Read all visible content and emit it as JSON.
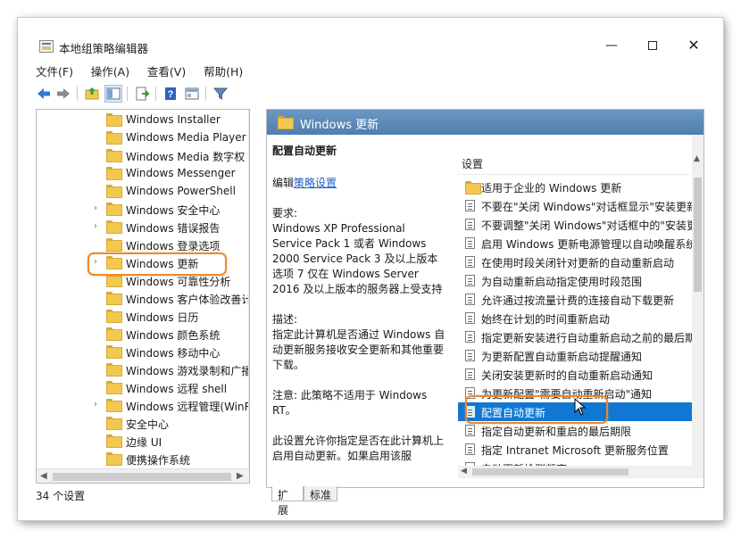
{
  "window": {
    "title": "本地组策略编辑器",
    "minimize": "—",
    "close": "✕"
  },
  "menu": [
    "文件(F)",
    "操作(A)",
    "查看(V)",
    "帮助(H)"
  ],
  "tree": {
    "items": [
      {
        "label": "Windows Installer",
        "expandable": false
      },
      {
        "label": "Windows Media Player",
        "expandable": false
      },
      {
        "label": "Windows Media 数字权",
        "expandable": false
      },
      {
        "label": "Windows Messenger",
        "expandable": false
      },
      {
        "label": "Windows PowerShell",
        "expandable": false
      },
      {
        "label": "Windows 安全中心",
        "expandable": true
      },
      {
        "label": "Windows 错误报告",
        "expandable": true
      },
      {
        "label": "Windows 登录选项",
        "expandable": false
      },
      {
        "label": "Windows 更新",
        "expandable": true,
        "selected": true
      },
      {
        "label": "Windows 可靠性分析",
        "expandable": false
      },
      {
        "label": "Windows 客户体验改善计",
        "expandable": false
      },
      {
        "label": "Windows 日历",
        "expandable": false
      },
      {
        "label": "Windows 颜色系统",
        "expandable": false
      },
      {
        "label": "Windows 移动中心",
        "expandable": false
      },
      {
        "label": "Windows 游戏录制和广播",
        "expandable": false
      },
      {
        "label": "Windows 远程 shell",
        "expandable": false
      },
      {
        "label": "Windows 远程管理(WinR",
        "expandable": true
      },
      {
        "label": "安全中心",
        "expandable": false
      },
      {
        "label": "边缘 UI",
        "expandable": false
      },
      {
        "label": "便携操作系统",
        "expandable": false
      }
    ]
  },
  "right_header": "Windows 更新",
  "description": {
    "title": "配置自动更新",
    "edit_prefix": "编辑",
    "edit_link": "策略设置",
    "requirements": "要求:\nWindows XP Professional Service Pack 1 或者 Windows 2000 Service Pack 3 及以上版本选项 7 仅在 Windows Server 2016 及以上版本的服务器上受支持",
    "description": "描述:\n指定此计算机是否通过 Windows 自动更新服务接收安全更新和其他重要下载。",
    "note": "注意: 此策略不适用于 Windows RT。",
    "more": "此设置允许你指定是否在此计算机上启用自动更新。如果启用该服"
  },
  "settings": {
    "header": "设置",
    "folder_item": "适用于企业的 Windows 更新",
    "items": [
      "不要在\"关闭 Windows\"对话框显示\"安装更新",
      "不要调整\"关闭 Windows\"对话框中的\"安装更",
      "启用 Windows 更新电源管理以自动唤醒系统",
      "在使用时段关闭针对更新的自动重新启动",
      "为自动重新启动指定使用时段范围",
      "允许通过按流量计费的连接自动下载更新",
      "始终在计划的时间重新启动",
      "指定更新安装进行自动重新启动之前的最后期",
      "为更新配置自动重新启动提醒通知",
      "关闭安装更新时的自动重新启动通知",
      "为更新配置\"需要自动重新启动\"通知",
      "配置自动更新",
      "指定自动更新和重启的最后期限",
      "指定 Intranet Microsoft 更新服务位置",
      "自动更新检测频率"
    ],
    "selected_index": 11
  },
  "tabs": [
    "扩展",
    "标准"
  ],
  "status": "34 个设置",
  "colors": {
    "header_blue": "#5b88b9",
    "selection_blue": "#1177d4",
    "highlight_orange": "#e98a32",
    "folder_yellow": "#f3c84f"
  }
}
